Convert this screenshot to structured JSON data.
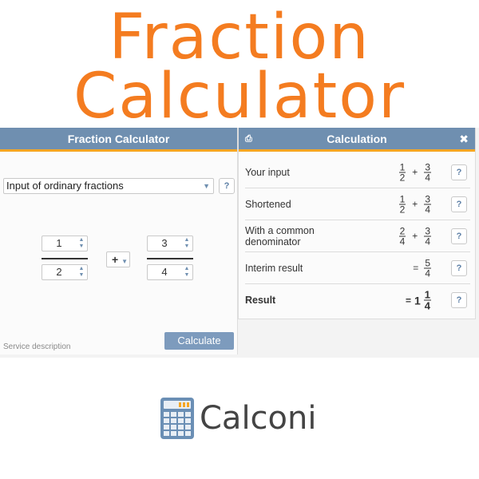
{
  "hero": {
    "line1": "Fraction",
    "line2": "Calculator"
  },
  "left_panel": {
    "title": "Fraction Calculator",
    "mode_select": "Input of ordinary fractions",
    "fraction1": {
      "numerator": "1",
      "denominator": "2"
    },
    "operator": "+",
    "fraction2": {
      "numerator": "3",
      "denominator": "4"
    },
    "help_label": "?",
    "service_description": "Service description",
    "calculate_label": "Calculate"
  },
  "right_panel": {
    "title": "Calculation",
    "close_glyph": "✖",
    "rows": [
      {
        "label": "Your input",
        "a_num": "1",
        "a_den": "2",
        "op": "+",
        "b_num": "3",
        "b_den": "4"
      },
      {
        "label": "Shortened",
        "a_num": "1",
        "a_den": "2",
        "op": "+",
        "b_num": "3",
        "b_den": "4"
      },
      {
        "label_line1": "With a common",
        "label_line2": "denominator",
        "a_num": "2",
        "a_den": "4",
        "op": "+",
        "b_num": "3",
        "b_den": "4"
      },
      {
        "label": "Interim result",
        "eq": "=",
        "num": "5",
        "den": "4"
      },
      {
        "label": "Result",
        "eq": "=",
        "whole": "1",
        "num": "1",
        "den": "4"
      }
    ]
  },
  "brand": {
    "name": "Calconi"
  },
  "colors": {
    "accent": "#f47c20",
    "header": "#6f8fb0",
    "header_stripe": "#f5a623"
  }
}
